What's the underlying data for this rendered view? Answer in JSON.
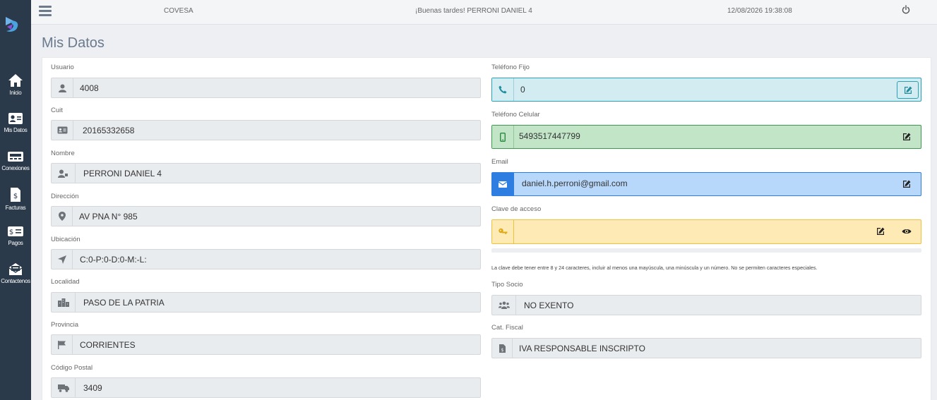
{
  "sidebar": {
    "items": [
      {
        "label": "Inicio",
        "icon": "home-icon"
      },
      {
        "label": "Mis Datos",
        "icon": "id-card-icon"
      },
      {
        "label": "Conexiones",
        "icon": "meter-icon"
      },
      {
        "label": "Facturas",
        "icon": "invoice-icon"
      },
      {
        "label": "Pagos",
        "icon": "money-icon"
      },
      {
        "label": "Contactenos",
        "icon": "envelope-open-icon"
      }
    ]
  },
  "topbar": {
    "company": "COVESA",
    "greeting": "¡Buenas tardes! PERRONI DANIEL 4",
    "datetime": "12/08/2026 19:38:08"
  },
  "page": {
    "title": "Mis Datos"
  },
  "left_fields": [
    {
      "label": "Usuario",
      "value": "4008",
      "icon": "user-icon"
    },
    {
      "label": "Cuit",
      "value": "20165332658",
      "icon": "id-card-icon"
    },
    {
      "label": "Nombre",
      "value": "PERRONI DANIEL 4",
      "icon": "user-tag-icon"
    },
    {
      "label": "Dirección",
      "value": "AV PNA N° 985",
      "icon": "map-marker-icon"
    },
    {
      "label": "Ubicación",
      "value": "C:0-P:0-D:0-M:-L:",
      "icon": "location-arrow-icon"
    },
    {
      "label": "Localidad",
      "value": "PASO DE LA PATRIA",
      "icon": "city-icon"
    },
    {
      "label": "Provincia",
      "value": "CORRIENTES",
      "icon": "flag-icon"
    },
    {
      "label": "Código Postal",
      "value": "3409",
      "icon": "truck-icon"
    }
  ],
  "right_fields": {
    "telefono_fijo": {
      "label": "Teléfono Fijo",
      "value": "0",
      "icon": "phone-icon"
    },
    "telefono_celular": {
      "label": "Teléfono Celular",
      "value": "5493517447799",
      "icon": "mobile-icon"
    },
    "email": {
      "label": "Email",
      "value": "daniel.h.perroni@gmail.com",
      "icon": "envelope-icon"
    },
    "clave": {
      "label": "Clave de acceso",
      "value": "",
      "icon": "key-icon"
    },
    "clave_hint": "La clave debe tener entre 8 y 24 caracteres, incluir al menos una mayúscula, una minúscula y un número. No se permiten caracteres especiales.",
    "tipo_socio": {
      "label": "Tipo Socio",
      "value": "NO EXENTO",
      "icon": "users-icon"
    },
    "cat_fiscal": {
      "label": "Cat. Fiscal",
      "value": "IVA RESPONSABLE INSCRIPTO",
      "icon": "file-invoice-icon"
    }
  },
  "colors": {
    "sidebar": "#2b3a4a",
    "telefono_fijo_bg": "#d3ecf1",
    "telefono_celular_bg": "#c2e4c7",
    "email_bg": "#b7d8fa",
    "clave_bg": "#fdeab4"
  }
}
